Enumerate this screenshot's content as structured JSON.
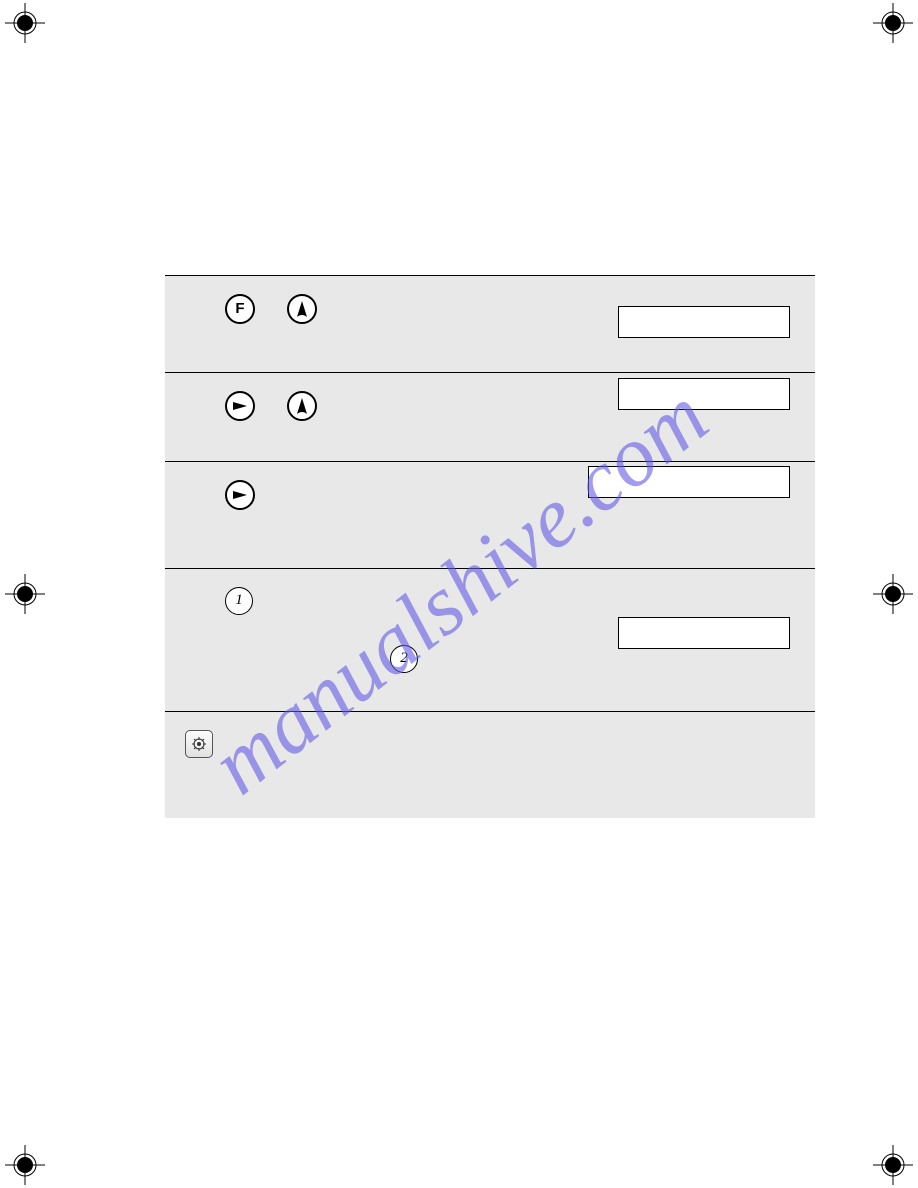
{
  "watermark": "manualshive.com",
  "icons": {
    "row1": [
      "F",
      "tree"
    ],
    "row2": [
      "arrow-right",
      "tree"
    ],
    "row3": [
      "arrow-right"
    ],
    "row4a": "1",
    "row4b": "2",
    "row5": "settings"
  },
  "displays": {
    "row1": "",
    "row2": "",
    "row3": "",
    "row4": ""
  }
}
